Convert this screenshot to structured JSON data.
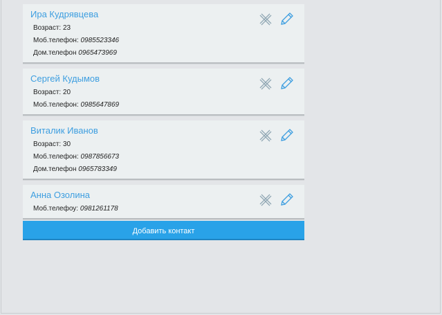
{
  "contacts": [
    {
      "name": "Ира Кудрявцева",
      "fields": [
        {
          "label": "Возраст:",
          "value": "23",
          "italic": false
        },
        {
          "label": "Моб.телефон:",
          "value": "0985523346",
          "italic": true
        },
        {
          "label": "Дом.телефон",
          "value": "0965473969",
          "italic": true
        }
      ]
    },
    {
      "name": "Сергей Кудымов",
      "fields": [
        {
          "label": "Возраст:",
          "value": "20",
          "italic": false
        },
        {
          "label": "Моб.телефон:",
          "value": "0985647869",
          "italic": true
        }
      ]
    },
    {
      "name": "Виталик Иванов",
      "fields": [
        {
          "label": "Возраст:",
          "value": "30",
          "italic": false
        },
        {
          "label": "Моб.телефон:",
          "value": "0987856673",
          "italic": true
        },
        {
          "label": "Дом.телефон",
          "value": "0965783349",
          "italic": true
        }
      ]
    },
    {
      "name": "Анна Озолина",
      "fields": [
        {
          "label": "Моб.телефоу:",
          "value": "0981261178",
          "italic": true
        }
      ]
    }
  ],
  "icons": {
    "delete": "close-icon",
    "edit": "pencil-icon"
  },
  "add_button_label": "Добавить контакт",
  "colors": {
    "accent": "#29a2e8",
    "name": "#3d9ee0",
    "card_bg": "#ecf0f1",
    "page_bg": "#e3e5e8"
  }
}
